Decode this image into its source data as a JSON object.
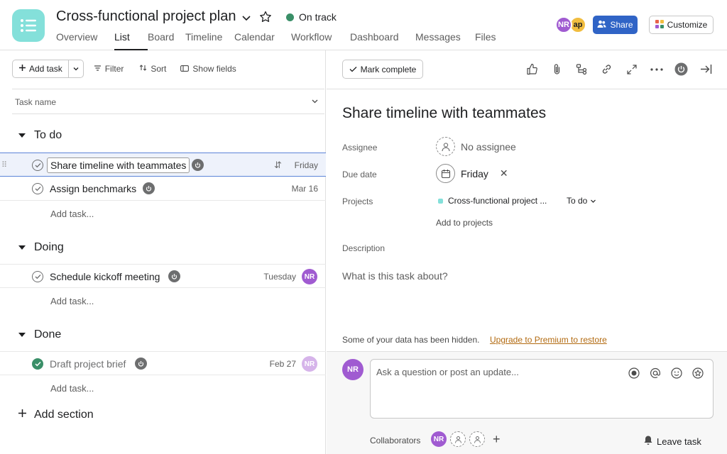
{
  "header": {
    "project_title": "Cross-functional project plan",
    "status": "On track",
    "status_color": "#3a8f68",
    "tabs": [
      {
        "label": "Overview",
        "active": false
      },
      {
        "label": "List",
        "active": true
      },
      {
        "label": "Board",
        "active": false
      },
      {
        "label": "Timeline",
        "active": false
      },
      {
        "label": "Calendar",
        "active": false
      },
      {
        "label": "Workflow",
        "active": false
      },
      {
        "label": "Dashboard",
        "active": false
      },
      {
        "label": "Messages",
        "active": false
      },
      {
        "label": "Files",
        "active": false
      }
    ],
    "avatars": [
      "NR",
      "ap"
    ],
    "share_label": "Share",
    "customize_label": "Customize"
  },
  "toolbar": {
    "add_task_label": "Add task",
    "filter_label": "Filter",
    "sort_label": "Sort",
    "show_fields_label": "Show fields"
  },
  "list": {
    "column_header": "Task name",
    "sections": [
      {
        "name": "To do",
        "tasks": [
          {
            "name": "Share timeline with teammates",
            "due": "Friday",
            "assignee": "",
            "completed": false,
            "selected": true
          },
          {
            "name": "Assign benchmarks",
            "due": "Mar 16",
            "assignee": "",
            "completed": false,
            "selected": false
          }
        ],
        "add_task_label": "Add task..."
      },
      {
        "name": "Doing",
        "tasks": [
          {
            "name": "Schedule kickoff meeting",
            "due": "Tuesday",
            "assignee": "NR",
            "completed": false,
            "selected": false
          }
        ],
        "add_task_label": "Add task..."
      },
      {
        "name": "Done",
        "tasks": [
          {
            "name": "Draft project brief",
            "due": "Feb 27",
            "assignee": "NR",
            "completed": true,
            "selected": false
          }
        ],
        "add_task_label": "Add task..."
      }
    ],
    "add_section_label": "Add section"
  },
  "detail": {
    "mark_complete_label": "Mark complete",
    "title": "Share timeline with teammates",
    "assignee_label": "Assignee",
    "assignee_value": "No assignee",
    "due_label": "Due date",
    "due_value": "Friday",
    "projects_label": "Projects",
    "project_name": "Cross-functional project ...",
    "project_section": "To do",
    "add_to_projects": "Add to projects",
    "description_label": "Description",
    "description_placeholder": "What is this task about?",
    "hidden_note": "Some of your data has been hidden.",
    "upgrade_link": "Upgrade to Premium to restore",
    "comment_avatar": "NR",
    "comment_placeholder": "Ask a question or post an update...",
    "collaborators_label": "Collaborators",
    "collaborator_avatar": "NR",
    "leave_task_label": "Leave task"
  },
  "colors": {
    "brand_teal": "#84e0da",
    "share_blue": "#3064c6",
    "avatar_purple": "#a05bd1",
    "avatar_yellow": "#f1bd3f",
    "upgrade_orange": "#b26a10"
  }
}
